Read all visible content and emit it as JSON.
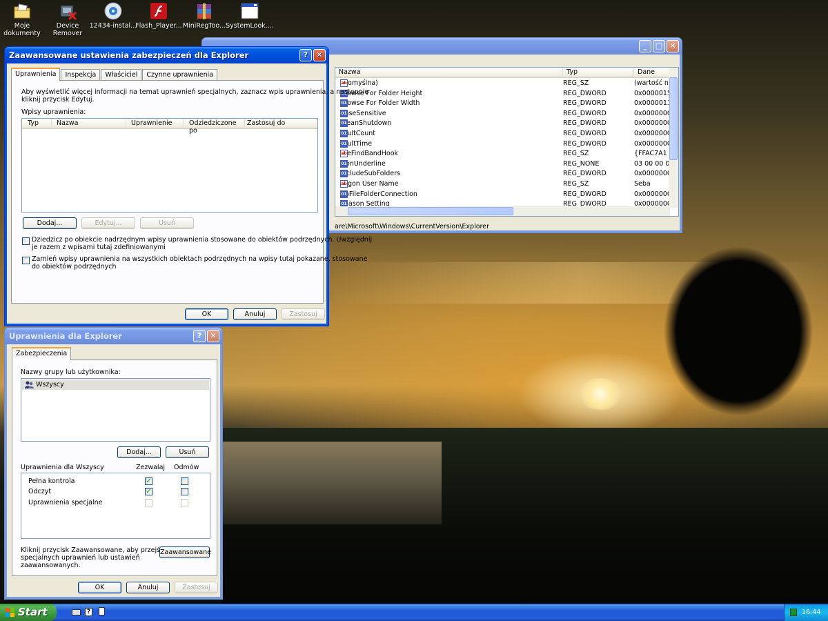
{
  "desktop": {
    "icons": [
      {
        "label_1": "Moje",
        "label_2": "dokumenty",
        "icon": "folder-documents-icon"
      },
      {
        "label_1": "Device",
        "label_2": "Remover",
        "icon": "device-remover-icon"
      },
      {
        "label_1": "12434-instal...",
        "label_2": "",
        "icon": "installer-icon"
      },
      {
        "label_1": "Flash_Player...",
        "label_2": "",
        "icon": "flash-icon"
      },
      {
        "label_1": "MiniRegToo...",
        "label_2": "",
        "icon": "archive-icon"
      },
      {
        "label_1": "SystemLook....",
        "label_2": "",
        "icon": "window-app-icon"
      }
    ]
  },
  "regedit": {
    "columns": {
      "name": "Nazwa",
      "type": "Typ",
      "data": "Dane"
    },
    "rows": [
      {
        "kind": "sz",
        "name": "(Domyślna)",
        "type": "REG_SZ",
        "data": "(wartość n"
      },
      {
        "kind": "dw",
        "name": "Browse For Folder Height",
        "type": "REG_DWORD",
        "data": "0x0000015"
      },
      {
        "kind": "dw",
        "name": "Browse For Folder Width",
        "type": "REG_DWORD",
        "data": "0x0000013"
      },
      {
        "kind": "dw",
        "name": "CaseSensitive",
        "type": "REG_DWORD",
        "data": "0x0000000"
      },
      {
        "kind": "dw",
        "name": "CleanShutdown",
        "type": "REG_DWORD",
        "data": "0x0000000"
      },
      {
        "kind": "dw",
        "name": "FaultCount",
        "type": "REG_DWORD",
        "data": "0x0000000"
      },
      {
        "kind": "dw",
        "name": "FaultTime",
        "type": "REG_DWORD",
        "data": "0x0000000"
      },
      {
        "kind": "sz",
        "name": "FileFindBandHook",
        "type": "REG_SZ",
        "data": "{FFAC7A1"
      },
      {
        "kind": "dw",
        "name": "IconUnderline",
        "type": "REG_NONE",
        "data": "03 00 00 0"
      },
      {
        "kind": "dw",
        "name": "IncludeSubFolders",
        "type": "REG_DWORD",
        "data": "0x0000000"
      },
      {
        "kind": "sz",
        "name": "Logon User Name",
        "type": "REG_SZ",
        "data": "Seba"
      },
      {
        "kind": "dw",
        "name": "NoFileFolderConnection",
        "type": "REG_DWORD",
        "data": "0x0000000"
      },
      {
        "kind": "dw",
        "name": "Reason Setting",
        "type": "REG_DWORD",
        "data": "0x0000000"
      }
    ],
    "status_path": "are\\Microsoft\\Windows\\CurrentVersion\\Explorer",
    "min_glyph": "_",
    "max_glyph": "□",
    "close_glyph": "✕"
  },
  "advanced": {
    "title": "Zaawansowane ustawienia zabezpieczeń dla Explorer",
    "help_glyph": "?",
    "close_glyph": "✕",
    "tabs": [
      "Uprawnienia",
      "Inspekcja",
      "Właściciel",
      "Czynne uprawnienia"
    ],
    "info_line_1": "Aby wyświetlić więcej informacji na temat uprawnień specjalnych, zaznacz wpis uprawnienia, a następnie",
    "info_line_2": "kliknij przycisk Edytuj.",
    "entries_label": "Wpisy uprawnienia:",
    "columns": [
      "Typ",
      "Nazwa",
      "Uprawnienie",
      "Odziedziczone po",
      "Zastosuj do"
    ],
    "add_label": "Dodaj...",
    "edit_label": "Edytuj...",
    "remove_label": "Usuń",
    "inherit_line_1": "Dziedzicz po obiekcie nadrzędnym wpisy uprawnienia stosowane do obiektów podrzędnych. Uwzględnij",
    "inherit_line_2": "je razem z wpisami tutaj zdefiniowanymi",
    "replace_line_1": "Zamień wpisy uprawnienia na wszystkich obiektach podrzędnych na wpisy tutaj pokazane, stosowane",
    "replace_line_2": "do obiektów podrzędnych",
    "ok_label": "OK",
    "cancel_label": "Anuluj",
    "apply_label": "Zastosuj"
  },
  "perms": {
    "title": "Uprawnienia dla Explorer",
    "help_glyph": "?",
    "close_glyph": "✕",
    "tab": "Zabezpieczenia",
    "group_label": "Nazwy grupy lub użytkownika:",
    "users": [
      "Wszyscy"
    ],
    "add_label": "Dodaj...",
    "remove_label": "Usuń",
    "perm_header": "Uprawnienia dla Wszyscy",
    "allow_header": "Zezwalaj",
    "deny_header": "Odmów",
    "permissions": [
      {
        "name": "Pełna kontrola",
        "allow": true,
        "deny": false,
        "enabled": true
      },
      {
        "name": "Odczyt",
        "allow": true,
        "deny": false,
        "enabled": true
      },
      {
        "name": "Uprawnienia specjalne",
        "allow": false,
        "deny": false,
        "enabled": false
      }
    ],
    "check_glyph": "✓",
    "advanced_info_1": "Kliknij przycisk Zaawansowane, aby przejść do",
    "advanced_info_2": "specjalnych uprawnień lub ustawień",
    "advanced_info_3": "zaawansowanych.",
    "advanced_label": "Zaawansowane",
    "ok_label": "OK",
    "cancel_label": "Anuluj",
    "apply_label": "Zastosuj"
  },
  "taskbar": {
    "start_label": "Start",
    "clock": "16:44",
    "quicklaunch": [
      "keyboard-icon",
      "help-icon",
      "notepad-icon"
    ]
  }
}
